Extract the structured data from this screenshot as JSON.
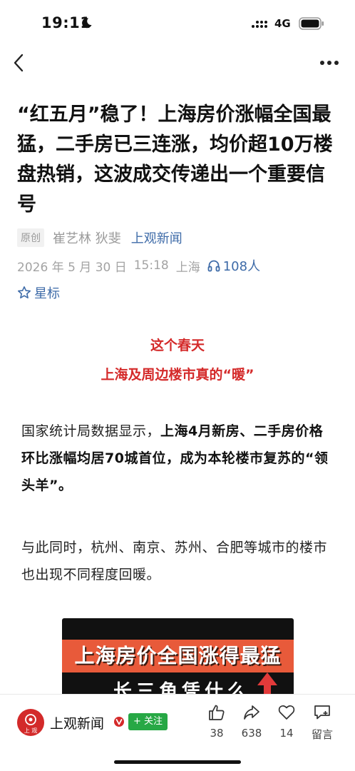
{
  "status_bar": {
    "time": "19:11",
    "network": "4G"
  },
  "nav": {
    "back_icon": "chevron-left-icon",
    "more_icon": "more-dots-icon"
  },
  "article": {
    "title": "“红五月”稳了！上海房价涨幅全国最猛，二手房已三连涨，均价超10万楼盘热销，这波成交传递出一个重要信号",
    "original_badge": "原创",
    "authors": "崔艺林 狄斐",
    "source": "上观新闻",
    "date": "2026 年 5 月 30 日",
    "time": "15:18",
    "location": "上海",
    "listen_count": "108人",
    "star_label": "星标",
    "section_heading_1": "这个春天",
    "section_heading_2": "上海及周边楼市真的“暖”",
    "para1_prefix": "国家统计局数据显示，",
    "para1_bold": "上海4月新房、二手房价格环比涨幅均居70城首位，成为本轮楼市复苏的“领头羊”。",
    "para2": "与此同时，杭州、南京、苏州、合肥等城市的楼市也出现不同程度回暖。",
    "image_line1": "上海房价全国涨得最猛",
    "image_line2": "长三角凭什么"
  },
  "bottom_bar": {
    "outlet_name": "上观新闻",
    "logo_text": "上 观",
    "follow_label": "+ 关注",
    "like_count": "38",
    "share_count": "638",
    "favorite_count": "14",
    "comment_label": "留言"
  },
  "colors": {
    "accent_red": "#d42a2a",
    "link_blue": "#3e6ba8",
    "follow_green": "#27a845"
  }
}
